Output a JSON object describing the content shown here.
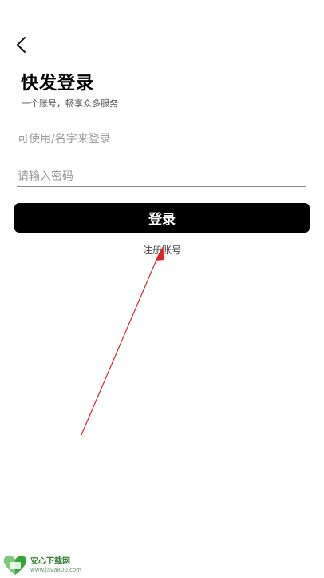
{
  "header": {
    "back_icon": "chevron-left-icon"
  },
  "login": {
    "title": "快发登录",
    "subtitle": "一个账号，畅享众多服务",
    "account_placeholder": "可使用/名字来登录",
    "password_placeholder": "请输入密码",
    "login_button": "登录",
    "register_link": "注册账号"
  },
  "annotation": {
    "arrow_color": "#d9262b"
  },
  "watermark": {
    "title": "安心下载网",
    "url": "www.java800.com",
    "logo_color": "#3aa33a"
  }
}
